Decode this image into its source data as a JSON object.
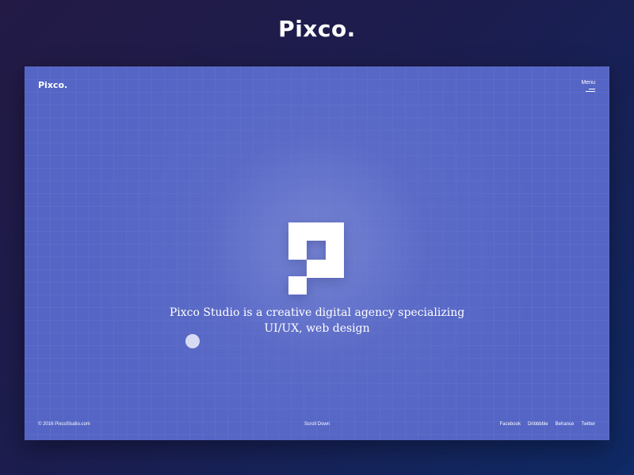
{
  "shot": {
    "title": "Pixco."
  },
  "header": {
    "brand": "Pixco.",
    "menu_label": "Menu",
    "menu_icon": "hamburger-icon"
  },
  "hero": {
    "logo_icon": "pixco-p-logo",
    "tagline_line1": "Pixco Studio is a creative digital agency specializing",
    "tagline_line2": "UI/UX, web design"
  },
  "footer": {
    "copyright": "© 2016 PixcoStudio.com",
    "scroll_label": "Scroll Down",
    "social": [
      "Facebook",
      "Dribbbble",
      "Behance",
      "Twitter"
    ]
  },
  "colors": {
    "outer_bg": "#1c1d4f",
    "frame_bg": "#5465c5",
    "text": "#ffffff"
  }
}
